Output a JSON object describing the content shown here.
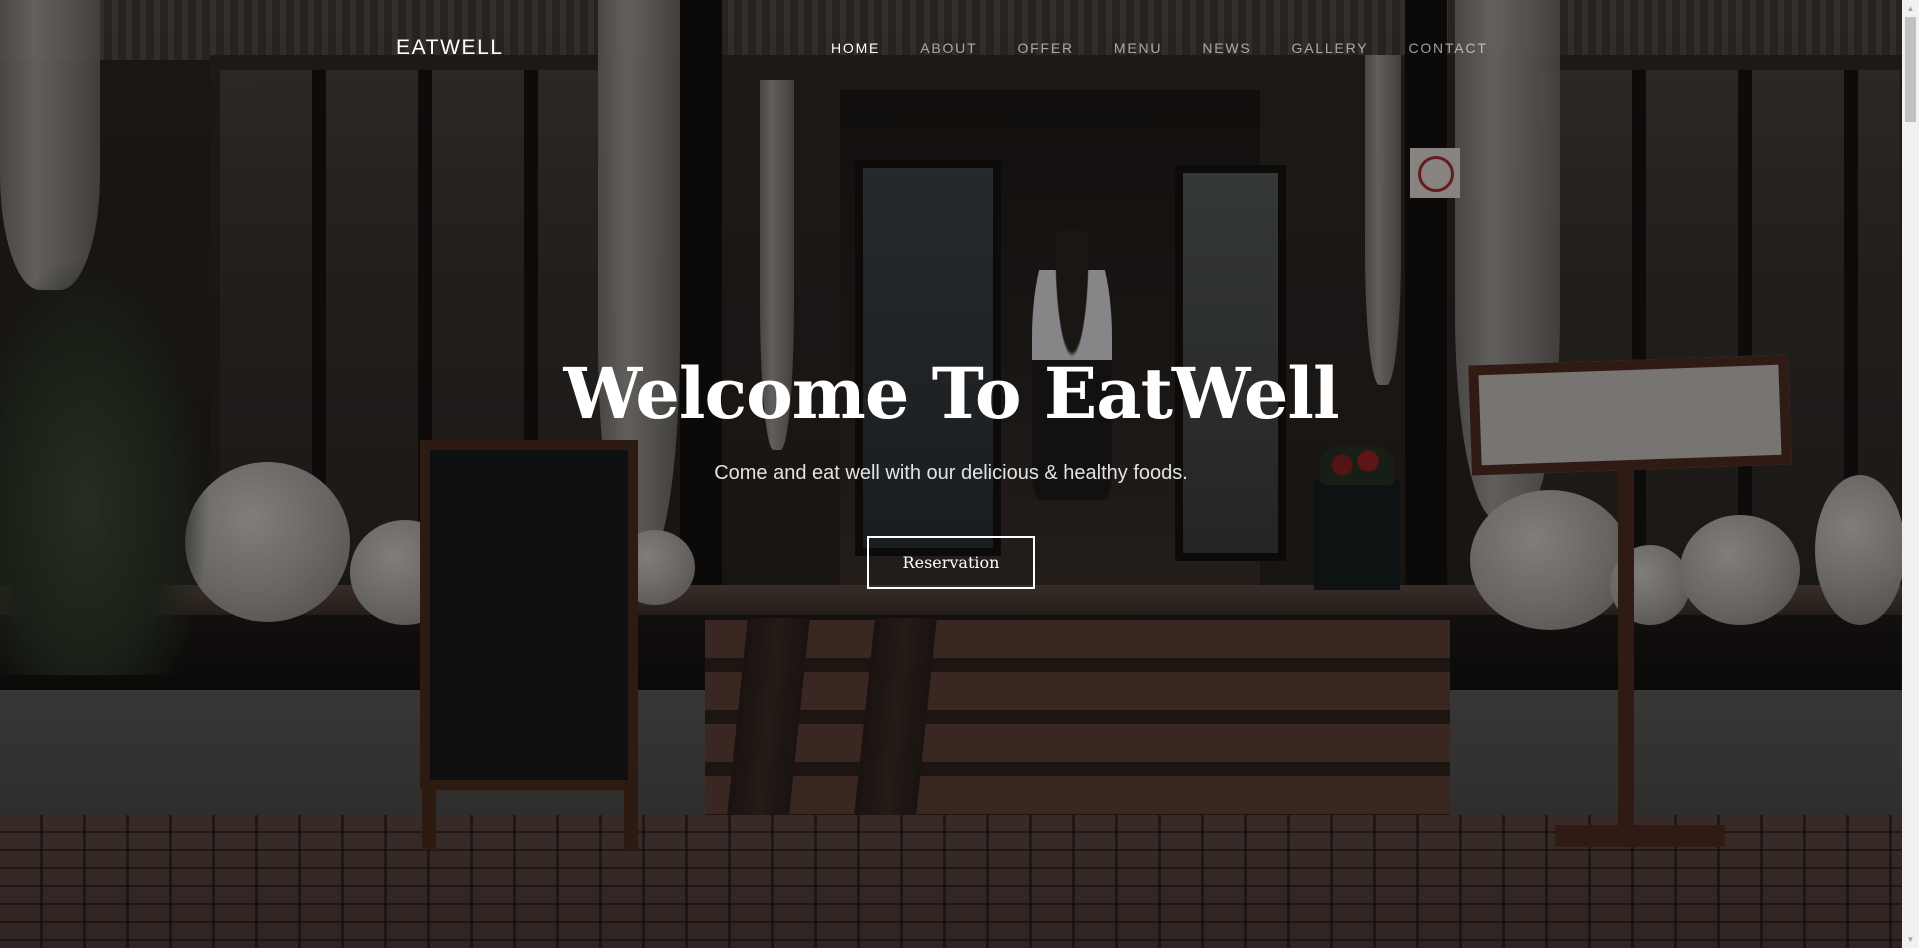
{
  "brand": {
    "name": "EATWELL"
  },
  "nav": {
    "items": [
      {
        "label": "HOME",
        "active": true
      },
      {
        "label": "ABOUT",
        "active": false
      },
      {
        "label": "OFFER",
        "active": false
      },
      {
        "label": "MENU",
        "active": false
      },
      {
        "label": "NEWS",
        "active": false
      },
      {
        "label": "GALLERY",
        "active": false
      },
      {
        "label": "CONTACT",
        "active": false
      }
    ]
  },
  "hero": {
    "title": "Welcome To EatWell",
    "subtitle": "Come and eat well with our delicious & healthy foods.",
    "button_label": "Reservation"
  },
  "scrollbar": {
    "up_icon": "▲",
    "down_icon": "▼"
  },
  "colors": {
    "text": "#ffffff",
    "nav_inactive": "rgba(255,255,255,0.6)",
    "overlay": "rgba(0,0,0,0.38)"
  }
}
